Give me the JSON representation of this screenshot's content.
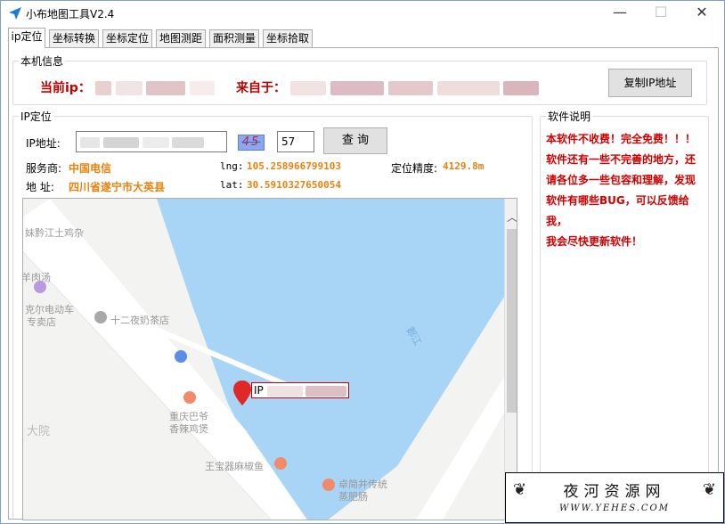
{
  "window": {
    "title": "小布地图工具V2.4",
    "minimize": "—",
    "maximize": "☐",
    "close": "✕"
  },
  "tabs": [
    {
      "label": "ip定位",
      "active": true
    },
    {
      "label": "坐标转换",
      "active": false
    },
    {
      "label": "坐标定位",
      "active": false
    },
    {
      "label": "地图测距",
      "active": false
    },
    {
      "label": "面积测量",
      "active": false
    },
    {
      "label": "坐标拾取",
      "active": false
    }
  ],
  "local_info": {
    "legend": "本机信息",
    "current_ip_label": "当前ip：",
    "from_label": "来自于：",
    "copy_button": "复制IP地址"
  },
  "ip_location": {
    "legend": "IP定位",
    "ip_label": "IP地址:",
    "captcha_text": "45",
    "captcha_input": "57",
    "query_button": "查 询",
    "isp_label": "服务商:",
    "isp_value": "中国电信",
    "lng_label": "lng:",
    "lng_value": "105.258966799103",
    "precision_label": "定位精度:",
    "precision_value": "4129.8m",
    "address_label": "地 址:",
    "address_value": "四川省遂宁市大英县",
    "lat_label": "lat:",
    "lat_value": "30.5910327650054"
  },
  "map": {
    "pois": [
      "妹黔江土鸡杂",
      "羊肉汤",
      "克尔电动车",
      "专卖店",
      "十二夜奶茶店",
      "重庆巴爷",
      "香辣鸡煲",
      "王宝器麻椒鱼",
      "卓简井传统",
      "蒸肥肠",
      "大院",
      "郪江"
    ],
    "marker_label": "IP"
  },
  "software_info": {
    "legend": "软件说明",
    "lines": [
      "本软件不收费！完全免费！！！",
      "软件还有一些不完善的地方，还",
      "请各位多一些包容和理解，发现",
      "软件有哪些BUG，可以反馈给我，",
      "我会尽快更新软件！"
    ]
  },
  "watermark": {
    "title": "夜河资源网",
    "url": "WWW.YEHES.COM"
  },
  "colors": {
    "red": "#c00000",
    "orange": "#e6820e",
    "water": "#a8d4f5"
  }
}
